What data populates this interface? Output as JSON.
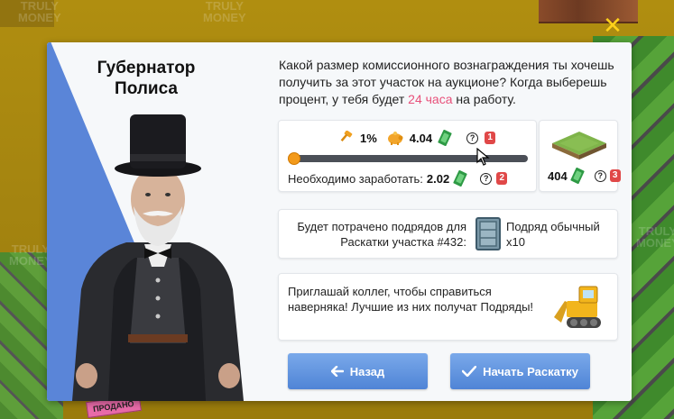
{
  "background": {
    "watermark_text": "TRULY\nMONEY",
    "sold_sign": "ПРОДАНО",
    "close_icon": "close-x-icon"
  },
  "npc": {
    "name": "Губернатор Полиса"
  },
  "intro": {
    "text_before": "Какой размер комиссионного вознаграждения ты хочешь получить за этот участок на аукционе? Когда выберешь процент, у тебя будет ",
    "highlight": "24 часа",
    "text_after": " на работу."
  },
  "commission": {
    "percent": "1%",
    "payout": "4.04",
    "slider_value": 0.0,
    "need_label": "Необходимо заработать:",
    "need_value": "2.02",
    "badge_1": "1",
    "badge_2": "2"
  },
  "plot": {
    "value": "404",
    "badge_3": "3"
  },
  "contract": {
    "text": "Будет потрачено подрядов для Раскатки участка #432:",
    "type": "Подряд обычный x10"
  },
  "invite": {
    "text": "Приглашай коллег, чтобы справиться наверняка! Лучшие из них получат Подряды!"
  },
  "buttons": {
    "back": "Назад",
    "start": "Начать Раскатку"
  },
  "colors": {
    "accent_blue": "#5a85d8",
    "button_blue": "#5f92dd",
    "highlight_pink": "#e8507a",
    "badge_red": "#e04848",
    "slider_orange": "#f39a1a",
    "close_yellow": "#ffd21a"
  }
}
